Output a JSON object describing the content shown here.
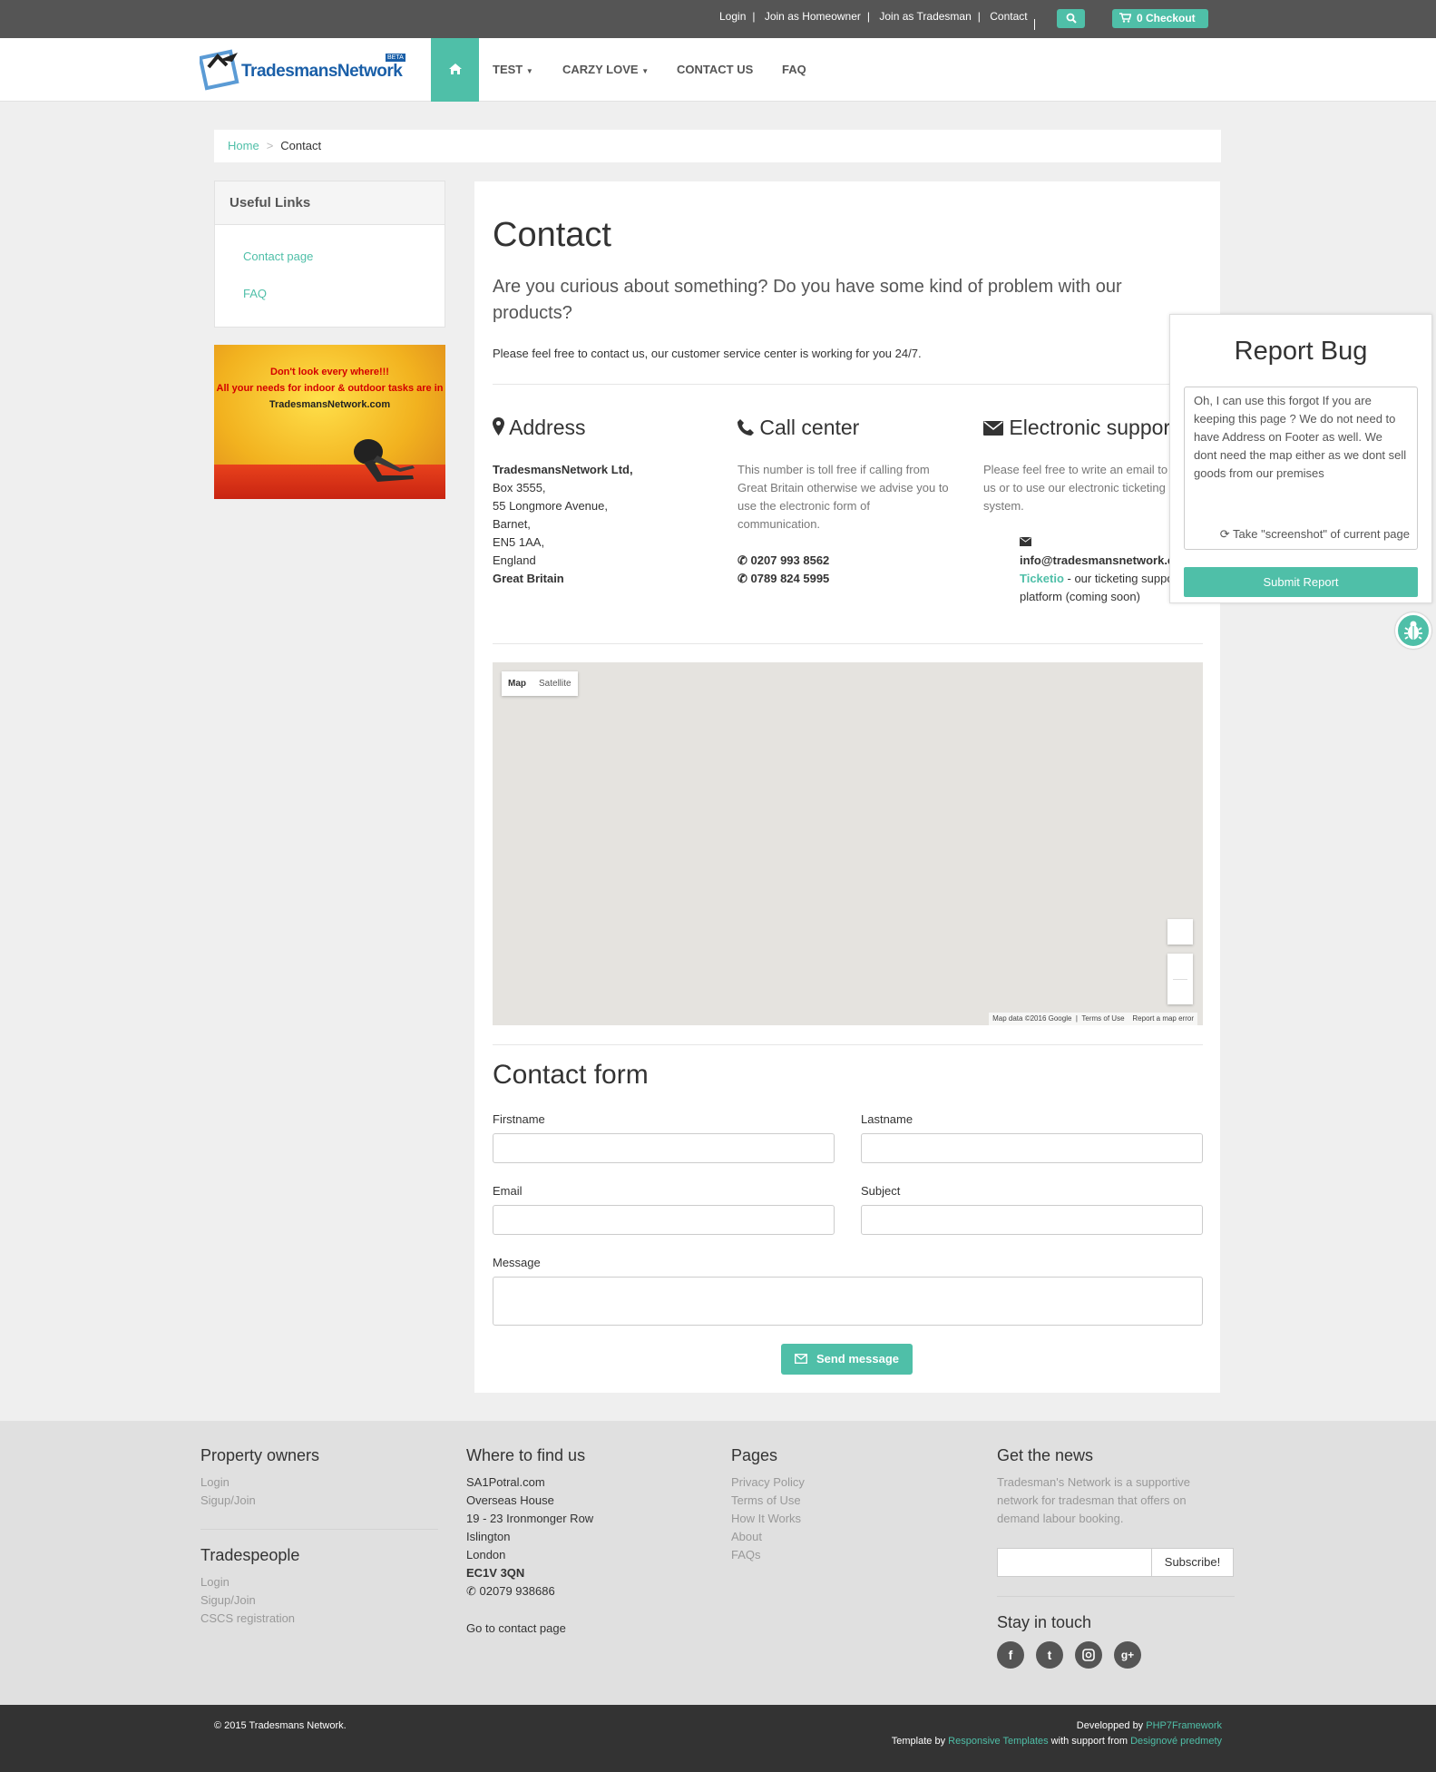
{
  "topbar": {
    "links": [
      "Login",
      "Join as Homeowner",
      "Join as Tradesman",
      "Contact"
    ],
    "checkout_label": "0 Checkout"
  },
  "nav": {
    "logo_text": "TradesmansNetwork",
    "logo_badge": "BETA",
    "items": [
      "TEST",
      "CARZY LOVE",
      "CONTACT US",
      "FAQ"
    ]
  },
  "breadcrumb": {
    "home": "Home",
    "current": "Contact"
  },
  "sidebar": {
    "title": "Useful Links",
    "links": [
      "Contact page",
      "FAQ"
    ],
    "banner": {
      "line1": "Don't look every where!!!",
      "line2": "All your needs for indoor & outdoor tasks are in",
      "line3": "TradesmansNetwork.com"
    }
  },
  "main": {
    "title": "Contact",
    "lead": "Are you curious about something? Do you have some kind of problem with our products?",
    "intro": "Please feel free to contact us, our customer service center is working for you 24/7.",
    "address": {
      "heading": "Address",
      "company": "TradesmansNetwork Ltd,",
      "lines": [
        "Box 3555,",
        "55 Longmore Avenue,",
        "Barnet,",
        "EN5 1AA,",
        "England"
      ],
      "country": "Great Britain"
    },
    "call": {
      "heading": "Call center",
      "text": "This number is toll free if calling from Great Britain otherwise we advise you to use the electronic form of communication.",
      "phone1": "0207 993 8562",
      "phone2": "0789 824 5995"
    },
    "electronic": {
      "heading": "Electronic support",
      "text": "Please feel free to write an email to us or to use our electronic ticketing system.",
      "email": "info@tradesmansnetwork.com",
      "ticket_link": "Ticketio",
      "ticket_text": " - our ticketing support platform (coming soon)"
    },
    "map": {
      "tab_map": "Map",
      "tab_satellite": "Satellite",
      "attribution": "Map data ©2016 Google",
      "terms": "Terms of Use",
      "report": "Report a map error"
    },
    "form": {
      "title": "Contact form",
      "firstname": "Firstname",
      "lastname": "Lastname",
      "email": "Email",
      "subject": "Subject",
      "message": "Message",
      "send": "Send message"
    }
  },
  "report_bug": {
    "title": "Report Bug",
    "text": "Oh, I can use this forgot If you are keeping this page ? We do not need to have Address on Footer as well. We dont need the map either as we dont sell goods from our premises",
    "screenshot_label": "Take \"screenshot\" of current page",
    "submit": "Submit Report"
  },
  "footer": {
    "property": {
      "heading": "Property owners",
      "links": [
        "Login",
        "Sigup/Join"
      ]
    },
    "trades": {
      "heading": "Tradespeople",
      "links": [
        "Login",
        "Sigup/Join",
        "CSCS registration"
      ]
    },
    "find": {
      "heading": "Where to find us",
      "lines": [
        "SA1Potral.com",
        "Overseas House",
        "19 - 23 Ironmonger Row",
        "Islington",
        "London"
      ],
      "postcode": "EC1V 3QN",
      "phone": "02079 938686",
      "contact_link": "Go to contact page"
    },
    "pages": {
      "heading": "Pages",
      "links": [
        "Privacy Policy",
        "Terms of Use",
        "How It Works",
        "About",
        "FAQs"
      ]
    },
    "news": {
      "heading": "Get the news",
      "text_lines": [
        "Tradesman's Network is a supportive",
        "network for tradesman that offers on",
        "demand labour booking."
      ],
      "subscribe": "Subscribe!"
    },
    "stay": {
      "heading": "Stay in touch",
      "icons": [
        "facebook-icon",
        "twitter-icon",
        "instagram-icon",
        "google-plus-icon"
      ]
    }
  },
  "bottom": {
    "copyright": "© 2015 Tradesmans Network.",
    "dev_prefix": "Developped by ",
    "dev_link": "PHP7Framework",
    "tpl_prefix": "Template by ",
    "tpl_link": "Responsive Templates",
    "tpl_mid": " with support from ",
    "tpl_link2": "Designové predmety"
  },
  "colors": {
    "accent": "#4fbfa8",
    "topbar": "#555555",
    "footer_bottom": "#333333"
  }
}
